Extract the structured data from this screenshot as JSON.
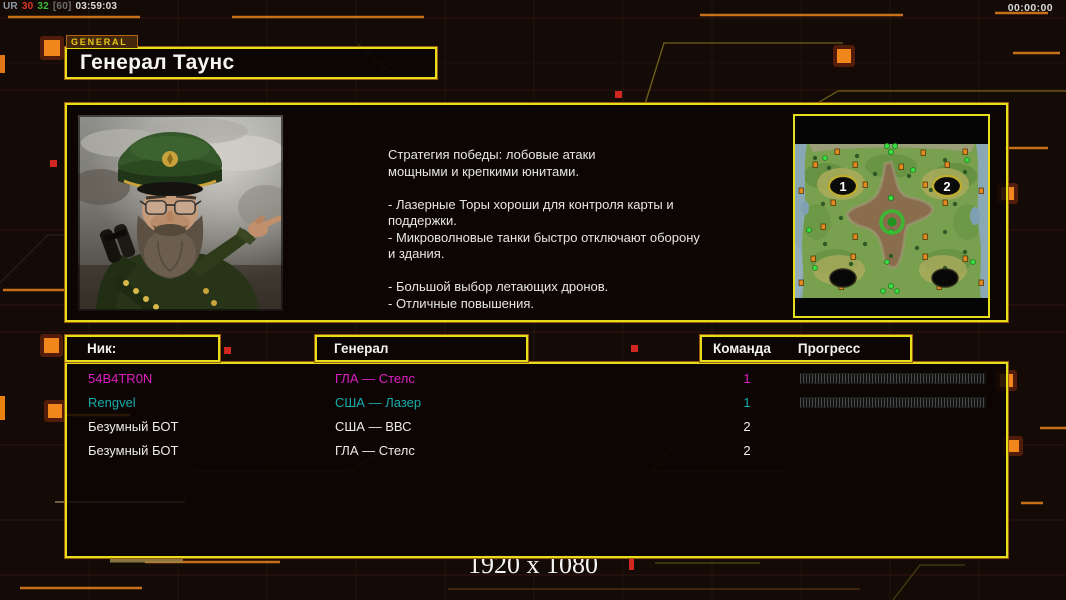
{
  "hud": {
    "debug": {
      "prefix": "UR",
      "v1": "30",
      "v2": "32",
      "v3": "[60]",
      "time": "03:59:03"
    },
    "clock": "00:00:00",
    "resolution": "1920 x 1080"
  },
  "general_tag": "GENERAL",
  "title": "Генерал Таунс",
  "strategy_text": "Стратегия победы: лобовые атаки\nмощными и крепкими юнитами.\n\n- Лазерные Торы хороши для контроля карты и\nподдержки.\n- Микроволновые танки быстро отключают оборону\nи здания.\n\n- Большой выбор летающих дронов.\n- Отличные повышения.",
  "map": {
    "marker1": "1",
    "marker2": "2"
  },
  "table": {
    "headers": {
      "nick": "Ник:",
      "general": "Генерал",
      "team": "Команда",
      "progress": "Прогресс"
    },
    "rows": [
      {
        "nick": "54B4TR0N",
        "general": "ГЛА — Стелс",
        "team": "1",
        "color": "#df1fc4",
        "has_progress": true
      },
      {
        "nick": "Rengvel",
        "general": "США — Лазер",
        "team": "1",
        "color": "#16acac",
        "has_progress": true
      },
      {
        "nick": "Безумный БОТ",
        "general": "США — ВВС",
        "team": "2",
        "color": "#ececec",
        "has_progress": false
      },
      {
        "nick": "Безумный БОТ",
        "general": "ГЛА — Стелс",
        "team": "2",
        "color": "#ececec",
        "has_progress": false
      }
    ]
  },
  "colors": {
    "accent_yellow": "#e7de1b",
    "accent_orange": "#ef8318",
    "magenta": "#df1fc4",
    "teal": "#16acac"
  }
}
